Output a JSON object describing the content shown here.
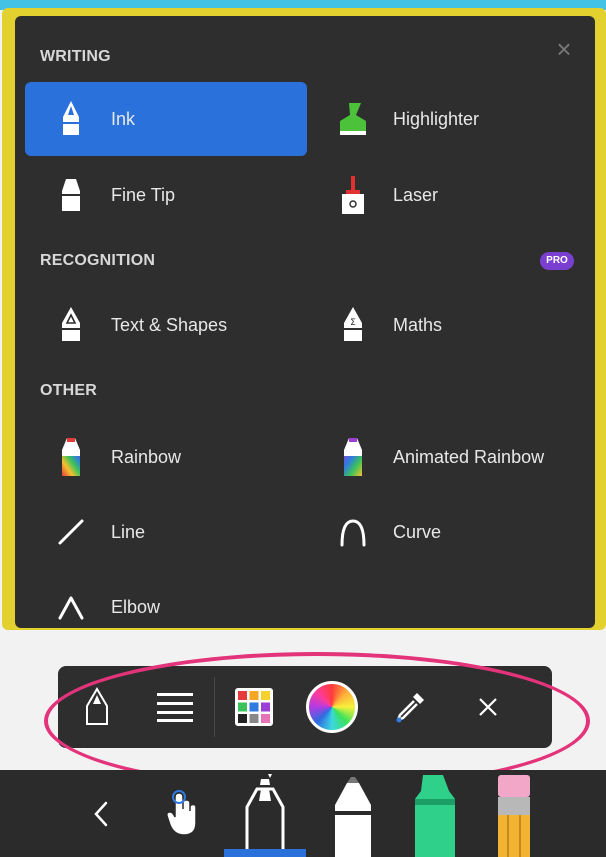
{
  "menu": {
    "sections": {
      "writing": "WRITING",
      "recognition": "RECOGNITION",
      "other": "OTHER"
    },
    "pro_badge": "PRO",
    "items": {
      "ink": "Ink",
      "highlighter": "Highlighter",
      "fine_tip": "Fine Tip",
      "laser": "Laser",
      "text_shapes": "Text & Shapes",
      "maths": "Maths",
      "rainbow": "Rainbow",
      "animated_rainbow": "Animated Rainbow",
      "line": "Line",
      "curve": "Curve",
      "elbow": "Elbow"
    },
    "selected": "ink"
  },
  "toolbar": {
    "buttons": [
      "pen-type-icon",
      "stroke-width-icon",
      "color-grid-icon",
      "color-wheel-icon",
      "eyedropper-icon",
      "close-icon"
    ]
  },
  "bottom_bar": {
    "items": [
      "back-chevron-icon",
      "hand-touch-icon",
      "ink-pen-icon",
      "fine-tip-icon",
      "highlighter-icon",
      "eraser-icon"
    ]
  },
  "colors": {
    "accent": "#2a71dc",
    "panel": "#2e2e2e",
    "annotation_yellow": "#e3d130",
    "annotation_pink": "#e3337a",
    "pro": "#7a3fd0"
  }
}
